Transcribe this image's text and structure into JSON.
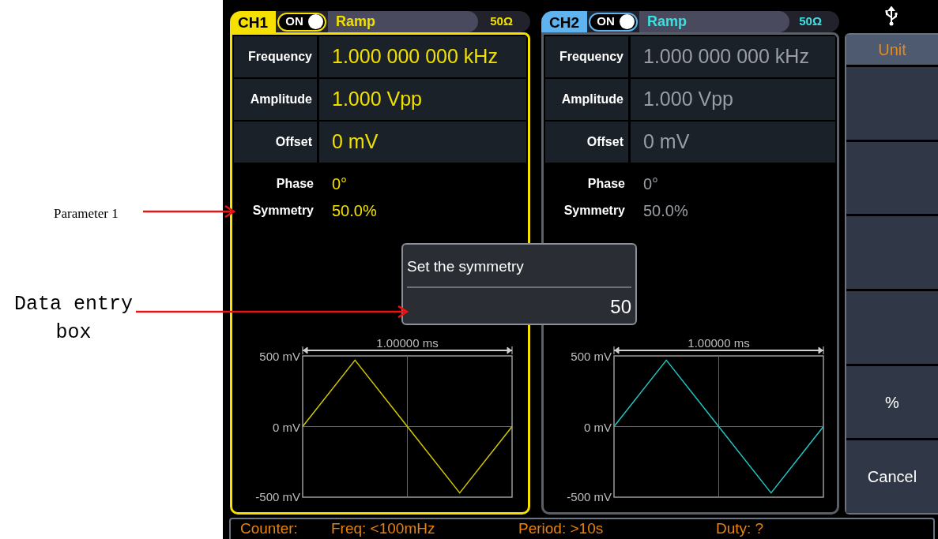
{
  "annotations": [
    {
      "text": "Parameter 1",
      "kind": "serif"
    },
    {
      "text": "Data entry box",
      "kind": "mono"
    }
  ],
  "channels": [
    {
      "name": "CH1",
      "color": "#f5e000",
      "active": true,
      "output_on": true,
      "on_label": "ON",
      "waveform": "Ramp",
      "load": {
        "label": "50Ω",
        "color": "#f0e000"
      },
      "params": [
        {
          "label": "Frequency",
          "value": "1.000 000 000 kHz",
          "kind": "boxed"
        },
        {
          "label": "Amplitude",
          "value": "1.000 Vpp",
          "kind": "boxed"
        },
        {
          "label": "Offset",
          "value": "0 mV",
          "kind": "boxed"
        },
        {
          "label": "Phase",
          "value": "0°",
          "kind": "plain"
        },
        {
          "label": "Symmetry",
          "value": "50.0%",
          "kind": "plain"
        }
      ],
      "chart_data": {
        "type": "line",
        "title": "1.00000 ms",
        "ylim": [
          -500,
          500
        ],
        "yticks": [
          {
            "value": 500,
            "label": "500 mV"
          },
          {
            "value": 0,
            "label": "0 mV"
          },
          {
            "value": -500,
            "label": "-500 mV"
          }
        ],
        "series": [
          {
            "color": "#d4c800",
            "values": [
              0,
              470,
              0,
              -470,
              0
            ]
          }
        ]
      }
    },
    {
      "name": "CH2",
      "color": "#5fb4f0",
      "active": false,
      "output_on": true,
      "on_label": "ON",
      "waveform": "Ramp",
      "load": {
        "label": "50Ω",
        "color": "#3de0e0"
      },
      "params": [
        {
          "label": "Frequency",
          "value": "1.000 000 000 kHz",
          "kind": "boxed"
        },
        {
          "label": "Amplitude",
          "value": "1.000 Vpp",
          "kind": "boxed"
        },
        {
          "label": "Offset",
          "value": "0 mV",
          "kind": "boxed"
        },
        {
          "label": "Phase",
          "value": "0°",
          "kind": "plain"
        },
        {
          "label": "Symmetry",
          "value": "50.0%",
          "kind": "plain"
        }
      ],
      "chart_data": {
        "type": "line",
        "title": "1.00000 ms",
        "ylim": [
          -500,
          500
        ],
        "yticks": [
          {
            "value": 500,
            "label": "500 mV"
          },
          {
            "value": 0,
            "label": "0 mV"
          },
          {
            "value": -500,
            "label": "-500 mV"
          }
        ],
        "series": [
          {
            "color": "#20c4c4",
            "values": [
              0,
              470,
              0,
              -470,
              0
            ]
          }
        ]
      }
    }
  ],
  "dialog": {
    "title": "Set the symmetry",
    "value": "50"
  },
  "softkeys": [
    {
      "kind": "title",
      "label": "Unit"
    },
    {
      "kind": "blank"
    },
    {
      "kind": "blank"
    },
    {
      "kind": "blank"
    },
    {
      "kind": "blank"
    },
    {
      "kind": "key",
      "label": "%"
    },
    {
      "kind": "key",
      "label": "Cancel"
    }
  ],
  "status_bar": [
    "Counter:",
    "Freq: <100mHz",
    "Period: >10s",
    "Duty: ?"
  ]
}
